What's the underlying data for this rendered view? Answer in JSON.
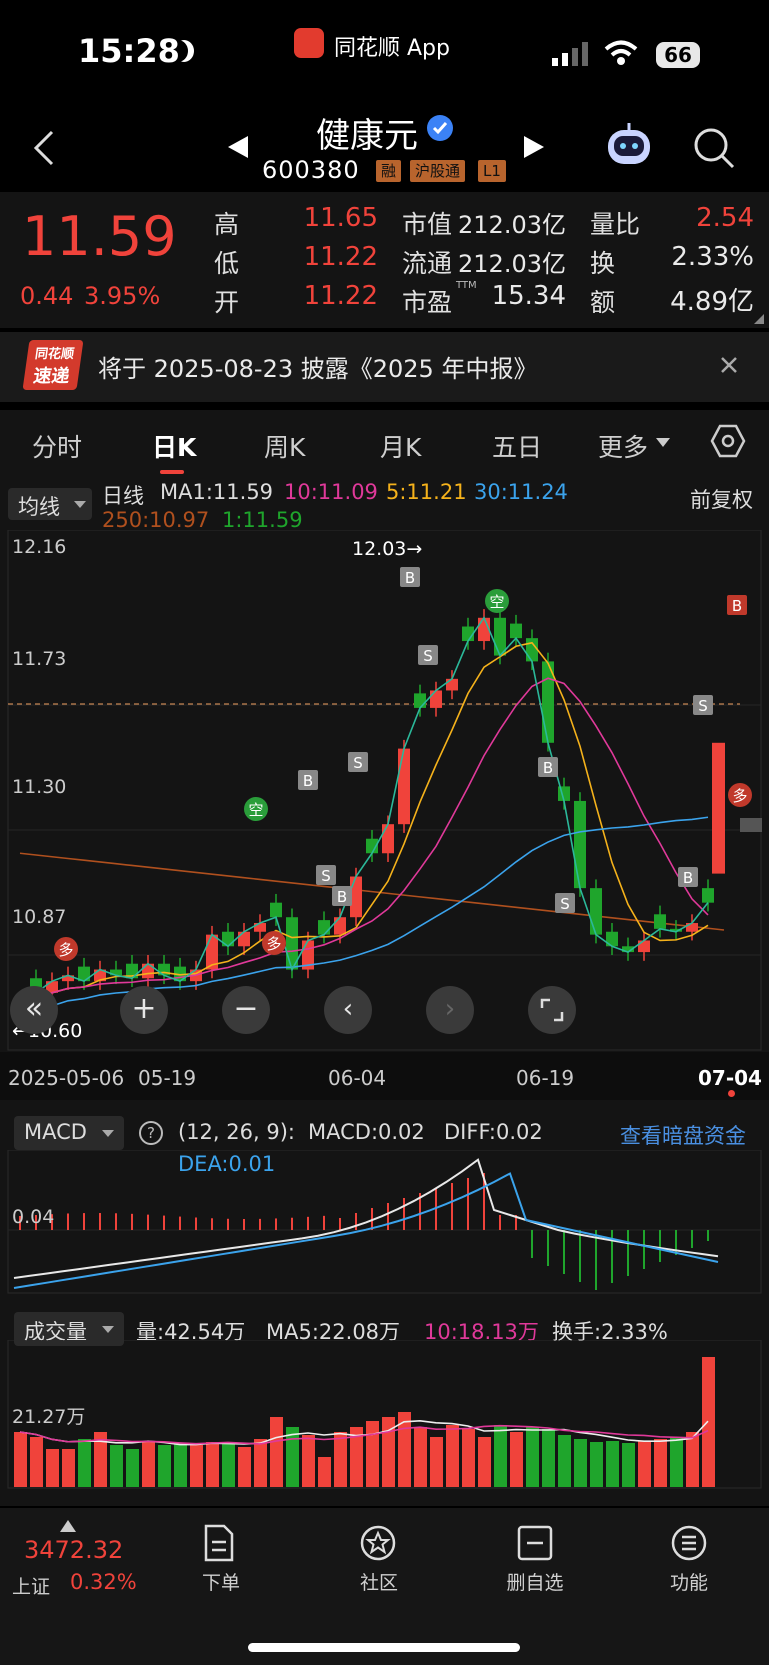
{
  "status_bar": {
    "time": "15:28",
    "app_name": "同花顺 App",
    "battery": "66"
  },
  "header": {
    "name": "健康元",
    "code": "600380",
    "tags": [
      "融",
      "沪股通",
      "L1"
    ]
  },
  "quote": {
    "price": "11.59",
    "change": "0.44",
    "change_pct": "3.95%",
    "rows": [
      {
        "l1": "高",
        "v1": "11.65",
        "l2": "市值",
        "v2": "212.03亿",
        "l3": "量比",
        "v3": "2.54"
      },
      {
        "l1": "低",
        "v1": "11.22",
        "l2": "流通",
        "v2": "212.03亿",
        "l3": "换",
        "v3": "2.33%"
      },
      {
        "l1": "开",
        "v1": "11.22",
        "l2": "市盈",
        "v2": "15.34",
        "l3": "额",
        "v3": "4.89亿"
      }
    ],
    "pe_sup": "TTM"
  },
  "notice": {
    "logo_top": "同花顺",
    "logo_bottom": "速递",
    "text": "将于 2025-08-23 披露《2025 年中报》"
  },
  "tabs": [
    "分时",
    "日K",
    "周K",
    "月K",
    "五日",
    "更多"
  ],
  "ma_bar": {
    "selector": "均线",
    "label": "日线",
    "ma1": "MA1:11.59",
    "ma10": "10:11.09",
    "ma5": "5:11.21",
    "ma30": "30:11.24",
    "ma250": "250:10.97",
    "ma_1": "1:11.59",
    "adjust": "前复权"
  },
  "kline": {
    "y_labels": [
      "12.16",
      "11.73",
      "11.30",
      "10.87"
    ],
    "high_marker": "12.03→",
    "low_marker": "←10.60",
    "dates": [
      "2025-05-06",
      "05-19",
      "06-04",
      "06-19",
      "07-04"
    ],
    "signals": {
      "B": "B",
      "S": "S",
      "kong": "空",
      "duo": "多"
    }
  },
  "macd": {
    "selector": "MACD",
    "params": "(12, 26, 9):",
    "macd": "MACD:0.02",
    "diff": "DIFF:0.02",
    "dea": "DEA:0.01",
    "link": "查看暗盘资金",
    "y_label": "0.04"
  },
  "volume": {
    "selector": "成交量",
    "vol": "量:42.54万",
    "ma5": "MA5:22.08万",
    "ma10": "10:18.13万",
    "turnover": "换手:2.33%",
    "y_label": "21.27万"
  },
  "index": {
    "value": "3472.32",
    "name": "上证",
    "pct": "0.32%"
  },
  "nav": [
    "下单",
    "社区",
    "删自选",
    "功能"
  ],
  "colors": {
    "up": "#f0433b",
    "down": "#1fa52c",
    "ma5": "#f5b21b",
    "ma10": "#e0399a",
    "ma30": "#3ba3ec",
    "ma250": "#b0501e",
    "accent": "#4a90e2"
  }
}
